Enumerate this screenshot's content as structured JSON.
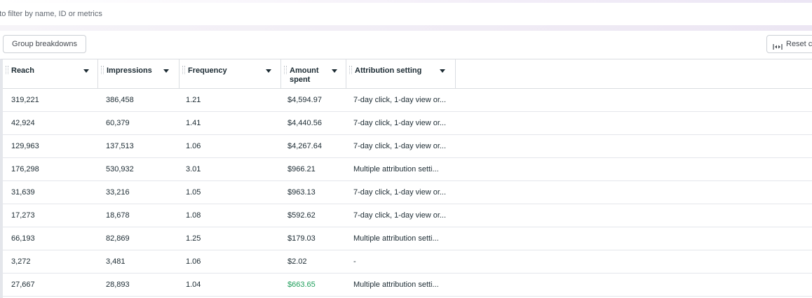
{
  "search": {
    "placeholder": "h to filter by name, ID or metrics"
  },
  "toolbar": {
    "group_breakdowns_label": "Group breakdowns",
    "reset_label": "Reset c"
  },
  "table": {
    "columns": [
      {
        "label": "Reach"
      },
      {
        "label": "Impressions"
      },
      {
        "label": "Frequency"
      },
      {
        "label": "Amount spent"
      },
      {
        "label": "Attribution setting"
      }
    ],
    "rows": [
      {
        "reach": "319,221",
        "impressions": "386,458",
        "frequency": "1.21",
        "amount_spent": "$4,594.97",
        "attribution": "7-day click, 1-day view or..."
      },
      {
        "reach": "42,924",
        "impressions": "60,379",
        "frequency": "1.41",
        "amount_spent": "$4,440.56",
        "attribution": "7-day click, 1-day view or..."
      },
      {
        "reach": "129,963",
        "impressions": "137,513",
        "frequency": "1.06",
        "amount_spent": "$4,267.64",
        "attribution": "7-day click, 1-day view or..."
      },
      {
        "reach": "176,298",
        "impressions": "530,932",
        "frequency": "3.01",
        "amount_spent": "$966.21",
        "attribution": "Multiple attribution setti..."
      },
      {
        "reach": "31,639",
        "impressions": "33,216",
        "frequency": "1.05",
        "amount_spent": "$963.13",
        "attribution": "7-day click, 1-day view or..."
      },
      {
        "reach": "17,273",
        "impressions": "18,678",
        "frequency": "1.08",
        "amount_spent": "$592.62",
        "attribution": "7-day click, 1-day view or..."
      },
      {
        "reach": "66,193",
        "impressions": "82,869",
        "frequency": "1.25",
        "amount_spent": "$179.03",
        "attribution": "Multiple attribution setti..."
      },
      {
        "reach": "3,272",
        "impressions": "3,481",
        "frequency": "1.06",
        "amount_spent": "$2.02",
        "attribution": "-"
      },
      {
        "reach": "27,667",
        "impressions": "28,893",
        "frequency": "1.04",
        "amount_spent": "$663.65",
        "attribution": "Multiple attribution setti..."
      }
    ],
    "highlight_color": "#1e9e5a"
  }
}
